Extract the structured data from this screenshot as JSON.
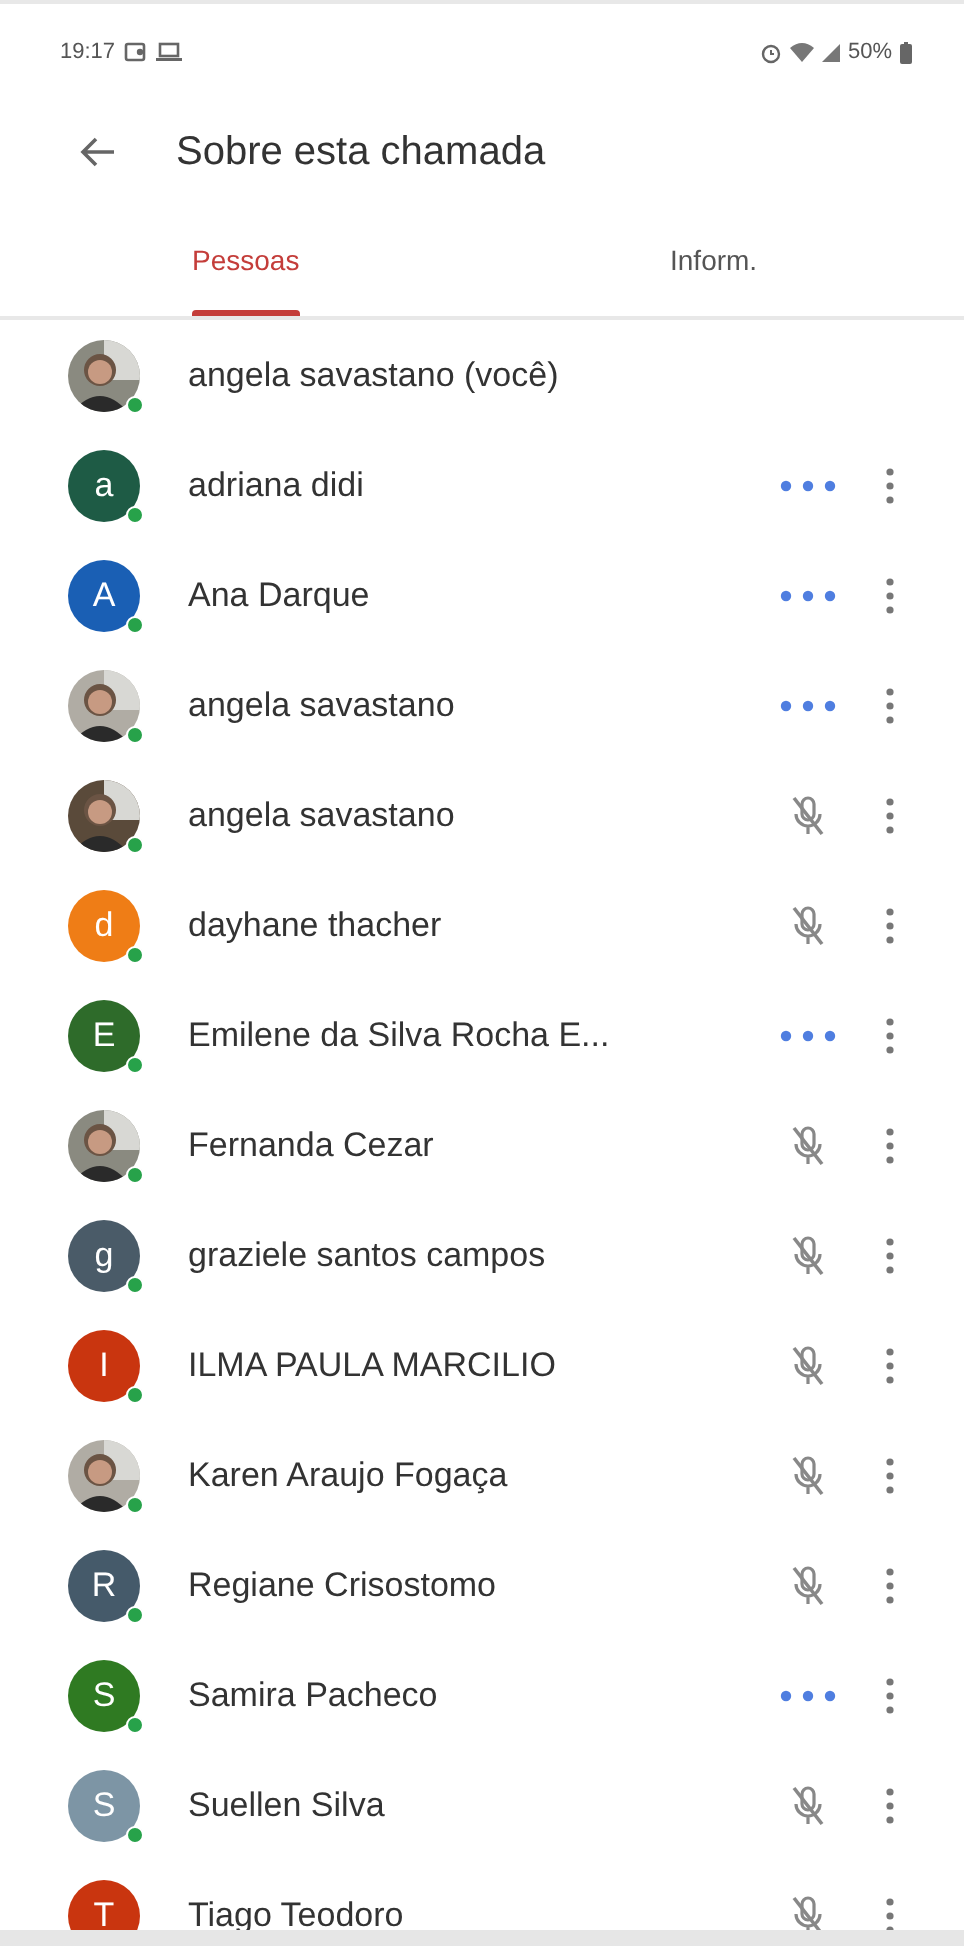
{
  "status_bar": {
    "time": "19:17",
    "battery": "50%"
  },
  "header": {
    "title": "Sobre esta chamada"
  },
  "tabs": [
    {
      "label": "Pessoas",
      "selected": true
    },
    {
      "label": "Inform.",
      "selected": false
    }
  ],
  "participants": [
    {
      "name": "angela savastano (você)",
      "online": true,
      "speaking": false,
      "muted": false,
      "menu": false
    },
    {
      "name": "adriana didi",
      "online": true,
      "avatar": {
        "kind": "letter",
        "initial": "a",
        "color": "#1e5b45"
      },
      "speaking": true,
      "muted": false,
      "menu": true
    },
    {
      "name": "Ana Darque",
      "online": true,
      "avatar": {
        "kind": "letter",
        "initial": "A",
        "color": "#1a5fb4"
      },
      "speaking": true,
      "muted": false,
      "menu": true
    },
    {
      "name": "angela savastano",
      "online": true,
      "speaking": true,
      "muted": false,
      "menu": true
    },
    {
      "name": "angela savastano",
      "online": true,
      "speaking": false,
      "muted": true,
      "menu": true
    },
    {
      "name": "dayhane thacher",
      "online": true,
      "avatar": {
        "kind": "letter",
        "initial": "d",
        "color": "#ef7d16"
      },
      "speaking": false,
      "muted": true,
      "menu": true
    },
    {
      "name": "Emilene da Silva Rocha E...",
      "online": true,
      "avatar": {
        "kind": "letter",
        "initial": "E",
        "color": "#2e6b2a"
      },
      "speaking": true,
      "muted": false,
      "menu": true
    },
    {
      "name": "Fernanda Cezar",
      "online": true,
      "speaking": false,
      "muted": true,
      "menu": true
    },
    {
      "name": "graziele santos campos",
      "online": true,
      "avatar": {
        "kind": "letter",
        "initial": "g",
        "color": "#4a5b68"
      },
      "speaking": false,
      "muted": true,
      "menu": true
    },
    {
      "name": "ILMA PAULA MARCILIO",
      "online": true,
      "avatar": {
        "kind": "letter",
        "initial": "I",
        "color": "#c9350f"
      },
      "speaking": false,
      "muted": true,
      "menu": true
    },
    {
      "name": "Karen Araujo Fogaça",
      "online": true,
      "speaking": false,
      "muted": true,
      "menu": true
    },
    {
      "name": "Regiane Crisostomo",
      "online": true,
      "avatar": {
        "kind": "letter",
        "initial": "R",
        "color": "#455a6a"
      },
      "speaking": false,
      "muted": true,
      "menu": true
    },
    {
      "name": "Samira Pacheco",
      "online": true,
      "avatar": {
        "kind": "letter",
        "initial": "S",
        "color": "#2f7a22"
      },
      "speaking": true,
      "muted": false,
      "menu": true
    },
    {
      "name": "Suellen Silva",
      "online": true,
      "avatar": {
        "kind": "letter",
        "initial": "S",
        "color": "#7d95a5"
      },
      "speaking": false,
      "muted": true,
      "menu": true
    },
    {
      "name": "Tiago Teodoro",
      "avatar": {
        "kind": "letter",
        "initial": "T",
        "color": "#c9350f"
      },
      "speaking": false,
      "muted": true,
      "menu": true
    }
  ]
}
